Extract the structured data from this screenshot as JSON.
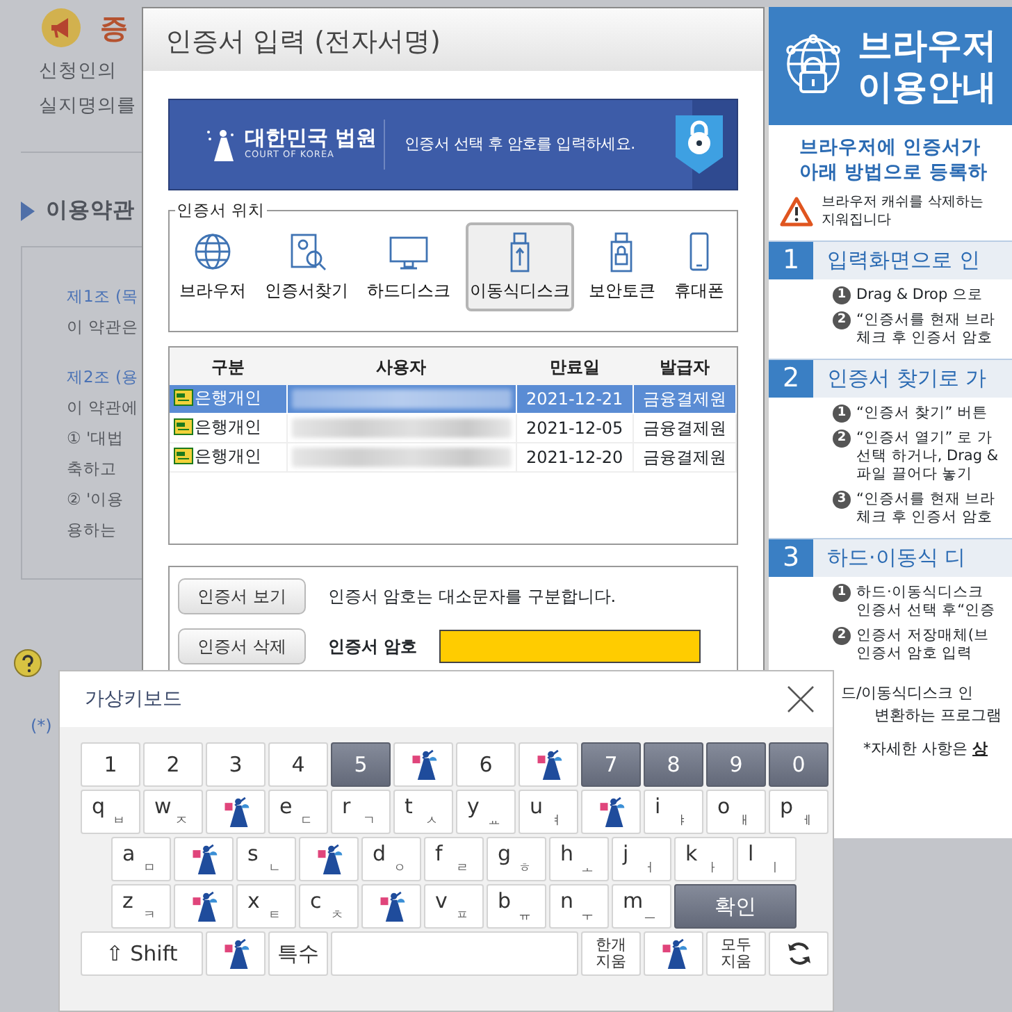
{
  "background_page": {
    "heading": "증",
    "intro": [
      "신청인의",
      "실지명의를"
    ],
    "section_title": "이용약관",
    "terms": [
      {
        "kind": "heading",
        "text": "제1조 (목"
      },
      {
        "kind": "body",
        "text": "이 약관은"
      },
      {
        "kind": "heading",
        "text": "제2조 (용"
      },
      {
        "kind": "body",
        "text": "이 약관에"
      },
      {
        "kind": "body",
        "text": "① '대법"
      },
      {
        "kind": "body",
        "text": "축하고"
      },
      {
        "kind": "body",
        "text": "② '이용"
      },
      {
        "kind": "body",
        "text": "용하는"
      }
    ],
    "footnote": "(*)"
  },
  "dialog": {
    "title": "인증서 입력 (전자서명)",
    "banner": {
      "org": "대한민국 법원",
      "org_en": "COURT OF KOREA",
      "message": "인증서 선택 후 암호를 입력하세요."
    },
    "location": {
      "legend": "인증서 위치",
      "options": [
        {
          "kind": "browser",
          "label": "브라우저",
          "selected": false
        },
        {
          "kind": "search",
          "label": "인증서찾기",
          "selected": false
        },
        {
          "kind": "harddisk",
          "label": "하드디스크",
          "selected": false
        },
        {
          "kind": "removable",
          "label": "이동식디스크",
          "selected": true
        },
        {
          "kind": "token",
          "label": "보안토큰",
          "selected": false
        },
        {
          "kind": "phone",
          "label": "휴대폰",
          "selected": false
        }
      ]
    },
    "table": {
      "columns": [
        "구분",
        "사용자",
        "만료일",
        "발급자"
      ],
      "rows": [
        {
          "type": "은행개인",
          "expires": "2021-12-21",
          "issuer": "금융결제원",
          "selected": true
        },
        {
          "type": "은행개인",
          "expires": "2021-12-05",
          "issuer": "금융결제원",
          "selected": false
        },
        {
          "type": "은행개인",
          "expires": "2021-12-20",
          "issuer": "금융결제원",
          "selected": false
        }
      ]
    },
    "buttons": [
      "인증서 보기",
      "인증서 삭제"
    ],
    "note": "인증서 암호는 대소문자를 구분합니다.",
    "password": {
      "label": "인증서 암호"
    }
  },
  "guide_panel": {
    "title": [
      "브라우저",
      "이용안내"
    ],
    "intro": [
      "브라우저에 인증서가",
      "아래 방법으로 등록하"
    ],
    "warning": [
      "브라우저 캐쉬를 삭제하는",
      "지워집니다"
    ],
    "steps": [
      {
        "number": "1",
        "title": "입력화면으로 인",
        "items": [
          {
            "number": "1",
            "lines": [
              "Drag & Drop 으로"
            ]
          },
          {
            "number": "2",
            "lines": [
              "“인증서를 현재 브라",
              "체크 후 인증서 암호"
            ]
          }
        ]
      },
      {
        "number": "2",
        "title": "인증서 찾기로 가",
        "items": [
          {
            "number": "1",
            "lines": [
              "“인증서 찾기” 버튼"
            ]
          },
          {
            "number": "2",
            "lines": [
              "“인증서 열기” 로 가",
              "선택 하거나, Drag &",
              "파일 끌어다 놓기"
            ]
          },
          {
            "number": "3",
            "lines": [
              "“인증서를 현재 브라",
              "체크 후 인증서 암호"
            ]
          }
        ]
      },
      {
        "number": "3",
        "title": "하드·이동식 디",
        "items": [
          {
            "number": "1",
            "lines": [
              "하드·이동식디스크",
              "인증서 선택 후“인증"
            ]
          },
          {
            "number": "2",
            "lines": [
              "인증서 저장매체(브",
              "인증서 암호 입력"
            ]
          }
        ]
      }
    ],
    "footer": [
      "드/이동식디스크 인",
      "변환하는 프로그램"
    ],
    "detail_text": "*자세한 사항은",
    "detail_link": "상"
  },
  "keyboard": {
    "title": "가상키보드",
    "rows": [
      {
        "keys": [
          {
            "kind": "char",
            "label": "1",
            "shaded": false
          },
          {
            "kind": "char",
            "label": "2",
            "shaded": false
          },
          {
            "kind": "char",
            "label": "3",
            "shaded": false
          },
          {
            "kind": "char",
            "label": "4",
            "shaded": false
          },
          {
            "kind": "char",
            "label": "5",
            "shaded": true
          },
          {
            "kind": "logo",
            "shaded": false
          },
          {
            "kind": "char",
            "label": "6",
            "shaded": false
          },
          {
            "kind": "logo",
            "shaded": false
          },
          {
            "kind": "char",
            "label": "7",
            "shaded": true
          },
          {
            "kind": "char",
            "label": "8",
            "shaded": true
          },
          {
            "kind": "char",
            "label": "9",
            "shaded": true
          },
          {
            "kind": "char",
            "label": "0",
            "shaded": true
          }
        ]
      },
      {
        "keys": [
          {
            "kind": "char",
            "label": "q",
            "sub": "ㅂ",
            "shaded": false
          },
          {
            "kind": "char",
            "label": "w",
            "sub": "ㅈ",
            "shaded": false
          },
          {
            "kind": "logo",
            "shaded": false
          },
          {
            "kind": "char",
            "label": "e",
            "sub": "ㄷ",
            "shaded": false
          },
          {
            "kind": "char",
            "label": "r",
            "sub": "ㄱ",
            "shaded": false
          },
          {
            "kind": "char",
            "label": "t",
            "sub": "ㅅ",
            "shaded": false
          },
          {
            "kind": "char",
            "label": "y",
            "sub": "ㅛ",
            "shaded": false
          },
          {
            "kind": "char",
            "label": "u",
            "sub": "ㅕ",
            "shaded": false
          },
          {
            "kind": "logo",
            "shaded": false
          },
          {
            "kind": "char",
            "label": "i",
            "sub": "ㅑ",
            "shaded": false
          },
          {
            "kind": "char",
            "label": "o",
            "sub": "ㅐ",
            "shaded": false
          },
          {
            "kind": "char",
            "label": "p",
            "sub": "ㅔ",
            "shaded": false
          }
        ]
      },
      {
        "keys": [
          {
            "kind": "char",
            "label": "a",
            "sub": "ㅁ",
            "shaded": false
          },
          {
            "kind": "logo",
            "shaded": false
          },
          {
            "kind": "char",
            "label": "s",
            "sub": "ㄴ",
            "shaded": false
          },
          {
            "kind": "logo",
            "shaded": false
          },
          {
            "kind": "char",
            "label": "d",
            "sub": "ㅇ",
            "shaded": false
          },
          {
            "kind": "char",
            "label": "f",
            "sub": "ㄹ",
            "shaded": false
          },
          {
            "kind": "char",
            "label": "g",
            "sub": "ㅎ",
            "shaded": false
          },
          {
            "kind": "char",
            "label": "h",
            "sub": "ㅗ",
            "shaded": false
          },
          {
            "kind": "char",
            "label": "j",
            "sub": "ㅓ",
            "shaded": false
          },
          {
            "kind": "char",
            "label": "k",
            "sub": "ㅏ",
            "shaded": false
          },
          {
            "kind": "char",
            "label": "l",
            "sub": "ㅣ",
            "shaded": false
          }
        ]
      },
      {
        "keys": [
          {
            "kind": "char",
            "label": "z",
            "sub": "ㅋ",
            "shaded": false
          },
          {
            "kind": "logo",
            "shaded": false
          },
          {
            "kind": "char",
            "label": "x",
            "sub": "ㅌ",
            "shaded": false
          },
          {
            "kind": "char",
            "label": "c",
            "sub": "ㅊ",
            "shaded": false
          },
          {
            "kind": "logo",
            "shaded": false
          },
          {
            "kind": "char",
            "label": "v",
            "sub": "ㅍ",
            "shaded": false
          },
          {
            "kind": "char",
            "label": "b",
            "sub": "ㅠ",
            "shaded": false
          },
          {
            "kind": "char",
            "label": "n",
            "sub": "ㅜ",
            "shaded": false
          },
          {
            "kind": "char",
            "label": "m",
            "sub": "ㅡ",
            "shaded": false
          },
          {
            "kind": "enter",
            "label": "확인",
            "shaded": true
          }
        ]
      },
      {
        "keys": [
          {
            "kind": "shift",
            "label": "⇧ Shift",
            "shaded": false
          },
          {
            "kind": "logo",
            "shaded": false
          },
          {
            "kind": "char",
            "label": "특수",
            "shaded": false
          },
          {
            "kind": "space",
            "shaded": false
          },
          {
            "kind": "char",
            "label": "한개 지움",
            "shaded": false
          },
          {
            "kind": "logo",
            "shaded": false
          },
          {
            "kind": "char",
            "label": "모두 지움",
            "shaded": false
          },
          {
            "kind": "refresh",
            "shaded": false
          }
        ]
      }
    ]
  }
}
